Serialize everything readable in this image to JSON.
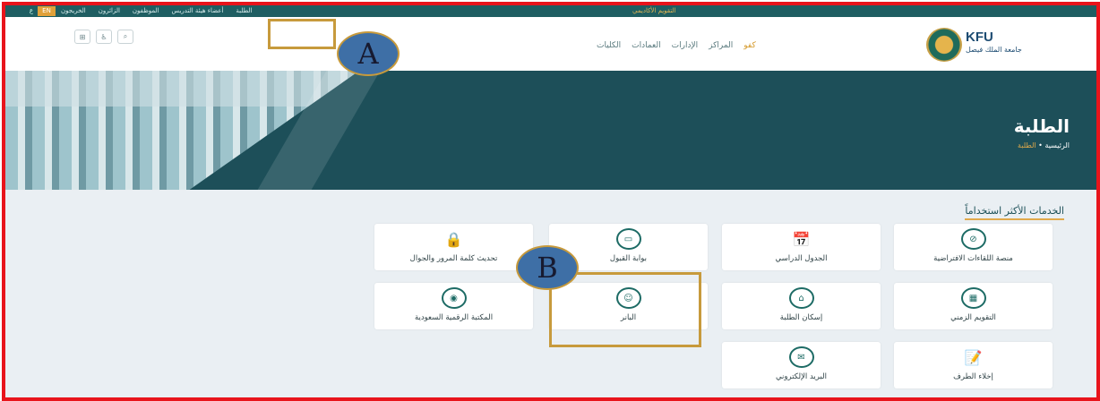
{
  "top_bar": {
    "lang_en": "EN",
    "lang_ar": "ع",
    "announcement": "التقويم الأكاديمي",
    "links": [
      "الطلبة",
      "أعضاء هيئة التدريس",
      "الموظفون",
      "الزائرون",
      "الخريجون"
    ]
  },
  "header": {
    "logo_text": "KFU",
    "logo_sub": "جامعة الملك فيصل",
    "icons": [
      "sitemap-icon",
      "accessibility-icon",
      "search-icon"
    ],
    "nav": [
      "الكليات",
      "العمادات",
      "الإدارات",
      "المراكز",
      "كفو"
    ]
  },
  "hero": {
    "title": "الطلبة",
    "breadcrumb_home": "الرئيسية",
    "breadcrumb_current": "الطلبة"
  },
  "services": {
    "title": "الخدمات الأكثر استخداماً",
    "items": [
      {
        "label": "منصة اللقاءات الافتراضية",
        "icon": "meeting-icon"
      },
      {
        "label": "الجدول الدراسي",
        "icon": "calendar-icon"
      },
      {
        "label": "بوابة القبول",
        "icon": "monitor-icon"
      },
      {
        "label": "تحديث كلمة المرور والجوال",
        "icon": "lock-icon"
      },
      {
        "label": "التقويم الزمني",
        "icon": "calendar-grid-icon"
      },
      {
        "label": "إسكان الطلبة",
        "icon": "bed-icon"
      },
      {
        "label": "البانر",
        "icon": "user-icon"
      },
      {
        "label": "المكتبة الرقمية السعودية",
        "icon": "library-icon"
      },
      {
        "label": "إخلاء الطرف",
        "icon": "document-icon"
      },
      {
        "label": "البريد الإلكتروني",
        "icon": "mail-icon"
      }
    ]
  },
  "annotations": {
    "a": "A",
    "b": "B"
  },
  "colors": {
    "frame": "#e8141b",
    "accent": "#c79a3c",
    "primary": "#1f5e62"
  }
}
